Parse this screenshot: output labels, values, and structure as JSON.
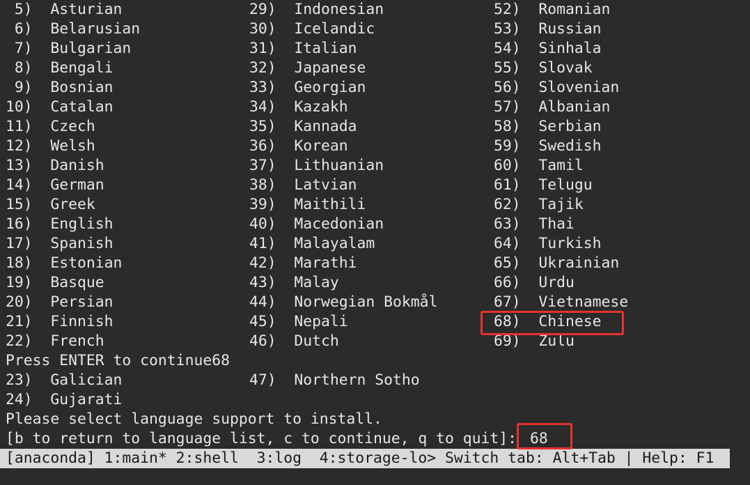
{
  "rows": [
    {
      "col1": " 5)  Asturian",
      "col2": "29)  Indonesian",
      "col3": "52)  Romanian"
    },
    {
      "col1": " 6)  Belarusian",
      "col2": "30)  Icelandic",
      "col3": "53)  Russian"
    },
    {
      "col1": " 7)  Bulgarian",
      "col2": "31)  Italian",
      "col3": "54)  Sinhala"
    },
    {
      "col1": " 8)  Bengali",
      "col2": "32)  Japanese",
      "col3": "55)  Slovak"
    },
    {
      "col1": " 9)  Bosnian",
      "col2": "33)  Georgian",
      "col3": "56)  Slovenian"
    },
    {
      "col1": "10)  Catalan",
      "col2": "34)  Kazakh",
      "col3": "57)  Albanian"
    },
    {
      "col1": "11)  Czech",
      "col2": "35)  Kannada",
      "col3": "58)  Serbian"
    },
    {
      "col1": "12)  Welsh",
      "col2": "36)  Korean",
      "col3": "59)  Swedish"
    },
    {
      "col1": "13)  Danish",
      "col2": "37)  Lithuanian",
      "col3": "60)  Tamil"
    },
    {
      "col1": "14)  German",
      "col2": "38)  Latvian",
      "col3": "61)  Telugu"
    },
    {
      "col1": "15)  Greek",
      "col2": "39)  Maithili",
      "col3": "62)  Tajik"
    },
    {
      "col1": "16)  English",
      "col2": "40)  Macedonian",
      "col3": "63)  Thai"
    },
    {
      "col1": "17)  Spanish",
      "col2": "41)  Malayalam",
      "col3": "64)  Turkish"
    },
    {
      "col1": "18)  Estonian",
      "col2": "42)  Marathi",
      "col3": "65)  Ukrainian"
    },
    {
      "col1": "19)  Basque",
      "col2": "43)  Malay",
      "col3": "66)  Urdu"
    },
    {
      "col1": "20)  Persian",
      "col2": "44)  Norwegian Bokmål",
      "col3": "67)  Vietnamese"
    },
    {
      "col1": "21)  Finnish",
      "col2": "45)  Nepali",
      "col3": "68)  Chinese"
    },
    {
      "col1": "22)  French",
      "col2": "46)  Dutch",
      "col3": "69)  Zulu"
    }
  ],
  "press_enter": "Press ENTER to continue68",
  "rows_after": [
    {
      "col1": "23)  Galician",
      "col2": "47)  Northern Sotho"
    },
    {
      "col1": "24)  Gujarati",
      "col2": ""
    }
  ],
  "select_prompt": "Please select language support to install.",
  "input_prompt": "[b to return to language list, c to continue, q to quit]:",
  "input_value": "68",
  "status_bar": "[anaconda] 1:main* 2:shell  3:log  4:storage-lo> Switch tab: Alt+Tab | Help: F1",
  "colors": {
    "background": "#2b2b2b",
    "text": "#e6e6e6",
    "status_bar_bg": "#d9d9d9",
    "highlight": "#e8312f"
  }
}
